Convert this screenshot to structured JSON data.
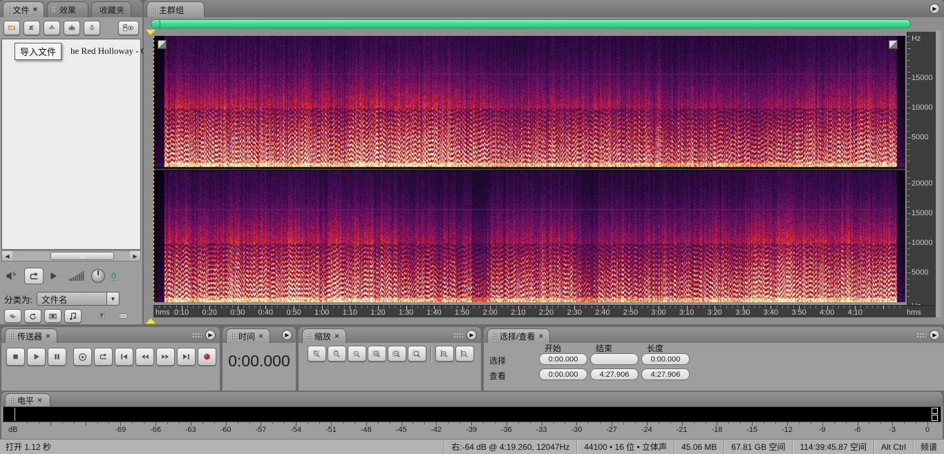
{
  "icons": {
    "flyout": "▶",
    "close": "×",
    "dropdown": "▼",
    "scroll_left": "◀",
    "scroll_right": "▶"
  },
  "files_panel": {
    "tabs": [
      {
        "label": "文件",
        "close": "×",
        "active": true
      },
      {
        "label": "效果",
        "active": false
      },
      {
        "label": "收藏夹",
        "active": false
      }
    ],
    "toolbar_buttons": [
      {
        "name": "import-file-button",
        "icon": "import-file"
      },
      {
        "name": "close-file-button",
        "icon": "close-file"
      },
      {
        "name": "import-audio-button",
        "icon": "import-audio"
      },
      {
        "name": "import-video-button",
        "icon": "import-video"
      },
      {
        "name": "extract-cd-button",
        "icon": "extract-cd"
      }
    ],
    "options_button": {
      "name": "display-options-button",
      "icon": "display-options"
    },
    "tooltip": "导入文件",
    "visible_file_text": "he Red Holloway - Cl",
    "sort_label": "分类为:",
    "sort_value": "文件名",
    "volume_value": "0",
    "filter_buttons": [
      {
        "name": "show-audio-files-button",
        "icon": "wave-box"
      },
      {
        "name": "auto-play-button",
        "icon": "loop-box"
      },
      {
        "name": "show-video-files-button",
        "icon": "film-box"
      },
      {
        "name": "show-midi-files-button",
        "icon": "note-box"
      },
      {
        "name": "filter-button",
        "icon": "funnel-eye"
      },
      {
        "name": "full-paths-button",
        "icon": "path-box"
      }
    ]
  },
  "main_group": {
    "tab_label": "主群组",
    "time_ruler": {
      "unit": "hms",
      "labels": [
        "0:10",
        "0:20",
        "0:30",
        "0:40",
        "0:50",
        "1:00",
        "1:10",
        "1:20",
        "1:30",
        "1:40",
        "1:50",
        "2:00",
        "2:10",
        "2:20",
        "2:30",
        "2:40",
        "2:50",
        "3:00",
        "3:10",
        "3:20",
        "3:30",
        "3:40",
        "3:50",
        "4:00",
        "4:10"
      ],
      "label_seconds": [
        10,
        20,
        30,
        40,
        50,
        60,
        70,
        80,
        90,
        100,
        110,
        120,
        130,
        140,
        150,
        160,
        170,
        180,
        190,
        200,
        210,
        220,
        230,
        240,
        250
      ],
      "view_end_seconds": 267.906
    },
    "freq_ruler": {
      "unit": "Hz",
      "max_hz": 22050,
      "top_channel_labels": [
        15000,
        10000,
        5000
      ],
      "bottom_channel_labels": [
        20000,
        15000,
        10000,
        5000
      ]
    }
  },
  "spectrogram": {
    "type": "spectrogram",
    "channels": 2,
    "view_start": "0:00.000",
    "view_end": "4:27.906",
    "freq_range_hz": [
      0,
      22050
    ],
    "tone_line_hz": 15700,
    "palette": [
      "#040108",
      "#220836",
      "#541060",
      "#96145c",
      "#ce203a",
      "#e8742a",
      "#ffc85a",
      "#fff6cd"
    ]
  },
  "transport_panel": {
    "title": "传送器",
    "close": "×",
    "buttons": [
      {
        "name": "stop-button",
        "icon": "stop"
      },
      {
        "name": "play-button",
        "icon": "play"
      },
      {
        "name": "pause-button",
        "icon": "pause"
      },
      {
        "name": "play-from-cursor-button",
        "icon": "playfrom"
      },
      {
        "name": "loop-play-button",
        "icon": "loop"
      },
      {
        "name": "go-to-beginning-button",
        "icon": "tostart"
      },
      {
        "name": "rewind-button",
        "icon": "rew"
      },
      {
        "name": "fast-forward-button",
        "icon": "ffw"
      },
      {
        "name": "go-to-end-button",
        "icon": "toend"
      },
      {
        "name": "record-button",
        "icon": "rec"
      }
    ]
  },
  "time_panel": {
    "title": "时间",
    "close": "×",
    "value": "0:00.000"
  },
  "zoom_panel": {
    "title": "缩放",
    "close": "×",
    "buttons": [
      {
        "name": "zoom-in-horizontal-button",
        "icon": "mag-in"
      },
      {
        "name": "zoom-out-horizontal-button",
        "icon": "mag-out"
      },
      {
        "name": "zoom-out-full-button",
        "icon": "mag-full"
      },
      {
        "name": "zoom-to-selection-button",
        "icon": "mag-sel"
      },
      {
        "name": "zoom-selection-left-button",
        "icon": "mag-sel-l"
      },
      {
        "name": "zoom-selection-right-button",
        "icon": "mag-sel-r"
      },
      {
        "name": "zoom-in-vertical-button",
        "icon": "mag-in-v"
      },
      {
        "name": "zoom-out-vertical-button",
        "icon": "mag-out-v"
      }
    ]
  },
  "selection_panel": {
    "title": "选择/查看",
    "close": "×",
    "columns": [
      "开始",
      "结束",
      "长度"
    ],
    "rows": [
      {
        "label": "选择",
        "values": [
          "0:00.000",
          "",
          "0:00.000"
        ]
      },
      {
        "label": "查看",
        "values": [
          "0:00.000",
          "4:27.906",
          "4:27.906"
        ]
      }
    ]
  },
  "levels_panel": {
    "title": "电平",
    "close": "×",
    "unit": "dB",
    "min_db": -78,
    "max_db": 0,
    "tick_labels": [
      -69,
      -66,
      -63,
      -60,
      -57,
      -54,
      -51,
      -48,
      -45,
      -42,
      -39,
      -36,
      -33,
      -30,
      -27,
      -24,
      -21,
      -18,
      -15,
      -12,
      -9,
      -6,
      -3,
      0
    ]
  },
  "status_bar": {
    "open_status": "打开 1.12 秒",
    "cells": [
      "右:-64 dB @  4:19.260, 12047Hz",
      "44100 • 16 位 • 立体声",
      "45.06 MB",
      "67.81 GB 空间",
      "114:39:45.87 空间",
      "Alt Ctrl",
      "频谱"
    ]
  }
}
